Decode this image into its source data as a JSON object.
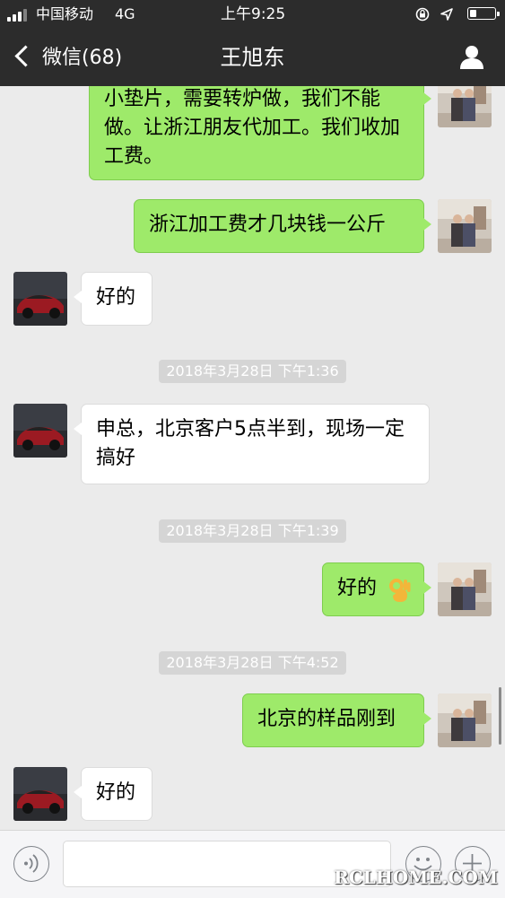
{
  "status_bar": {
    "carrier": "中国移动",
    "network": "4G",
    "time": "上午9:25"
  },
  "nav": {
    "back_label": "微信(68)",
    "title": "王旭东"
  },
  "messages": [
    {
      "sender": "self",
      "text": "小垫片，需要转炉做，我们不能做。让浙江朋友代加工。我们收加工费。"
    },
    {
      "sender": "self",
      "text": "浙江加工费才几块钱一公斤"
    },
    {
      "sender": "other",
      "text": "好的"
    },
    {
      "timestamp": "2018年3月28日 下午1:36"
    },
    {
      "sender": "other",
      "text": "申总，北京客户5点半到，现场一定搞好"
    },
    {
      "timestamp": "2018年3月28日 下午1:39"
    },
    {
      "sender": "self",
      "text": "好的",
      "emoji": "ok-hand"
    },
    {
      "timestamp": "2018年3月28日 下午4:52"
    },
    {
      "sender": "self",
      "text": "北京的样品刚到"
    },
    {
      "sender": "other",
      "text": "好的"
    }
  ],
  "watermark": "RCLHOME.COM",
  "colors": {
    "nav_bg": "#2c2c2c",
    "chat_bg": "#ebebeb",
    "self_bubble": "#9eea6a",
    "other_bubble": "#ffffff"
  },
  "icons": [
    "signal-icon",
    "lock-rotation-icon",
    "location-arrow-icon",
    "battery-icon",
    "back-chevron-icon",
    "user-icon",
    "voice-icon",
    "emoji-icon",
    "plus-icon"
  ]
}
